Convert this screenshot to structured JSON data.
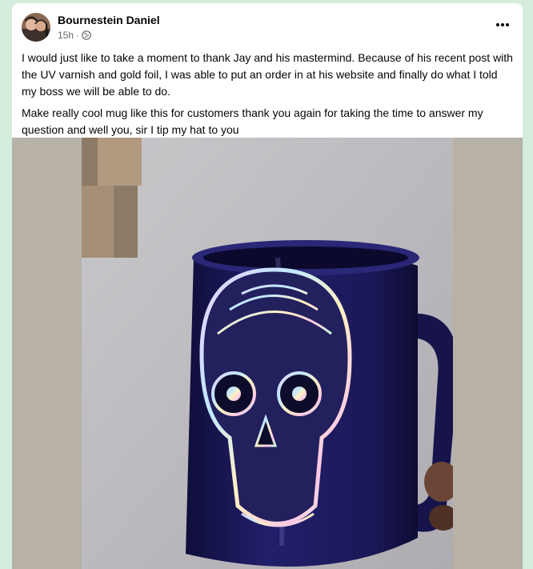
{
  "post": {
    "author": "Bournestein Daniel",
    "time": "15h",
    "separator": "·",
    "privacy_icon": "globe-icon",
    "menu_icon": "more-horizontal-icon",
    "paragraphs": [
      "I would just like to take a moment to thank Jay and his mastermind. Because of his recent post with the UV varnish and gold foil, I was able to put an order in at his website and finally do what I told my boss we will be able to do.",
      "Make really cool mug like this for customers thank you again for taking the time to answer my question and  well you, sir I tip my hat to you"
    ]
  },
  "colors": {
    "page_bg": "#d4ecdc",
    "card_bg": "#ffffff",
    "text": "#050505",
    "meta": "#65676b",
    "mug": "#1c1a5c"
  }
}
